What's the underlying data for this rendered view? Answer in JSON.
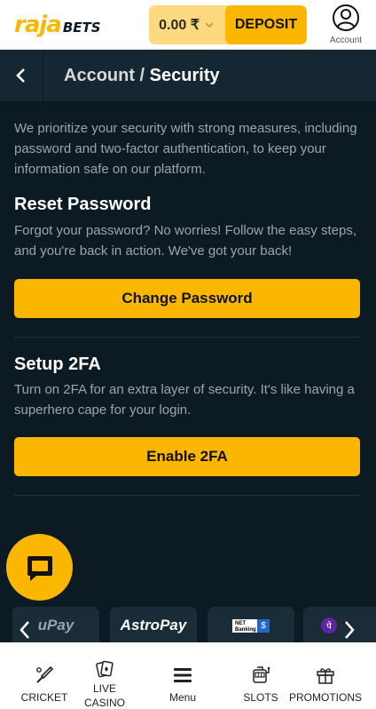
{
  "brand": {
    "name_part1": "raja",
    "name_part2": "BETS",
    "accent": "#fbb700"
  },
  "header": {
    "balance": "0.00 ₹",
    "deposit_label": "DEPOSIT",
    "account_label": "Account"
  },
  "page": {
    "breadcrumb_parent": "Account",
    "separator": " / ",
    "title": "Security"
  },
  "intro": "We prioritize your security with strong measures, including password and two-factor authentication, to keep your information safe on our platform.",
  "sections": [
    {
      "title": "Reset Password",
      "description": "Forgot your password? No worries! Follow the easy steps, and you're back in action. We've got your back!",
      "button_label": "Change Password"
    },
    {
      "title": "Setup 2FA",
      "description": "Turn on 2FA for an extra layer of security. It's like having a superhero cape for your login.",
      "button_label": "Enable 2FA"
    }
  ],
  "payments": [
    {
      "label": "uPay",
      "icon": "upi-logo"
    },
    {
      "label": "AstroPay",
      "icon": "astropay-logo"
    },
    {
      "label": "NET Banking",
      "icon": "netbanking-logo"
    },
    {
      "label": "PhonePe",
      "icon": "phonepe-logo"
    }
  ],
  "bottom_nav": [
    {
      "label": "CRICKET",
      "icon": "cricket-bat-icon"
    },
    {
      "label": "LIVE CASINO",
      "icon": "playing-cards-icon"
    },
    {
      "label": "Menu",
      "icon": "hamburger-menu-icon"
    },
    {
      "label": "SLOTS",
      "icon": "slot-machine-icon"
    },
    {
      "label": "PROMOTIONS",
      "icon": "gift-icon"
    }
  ]
}
